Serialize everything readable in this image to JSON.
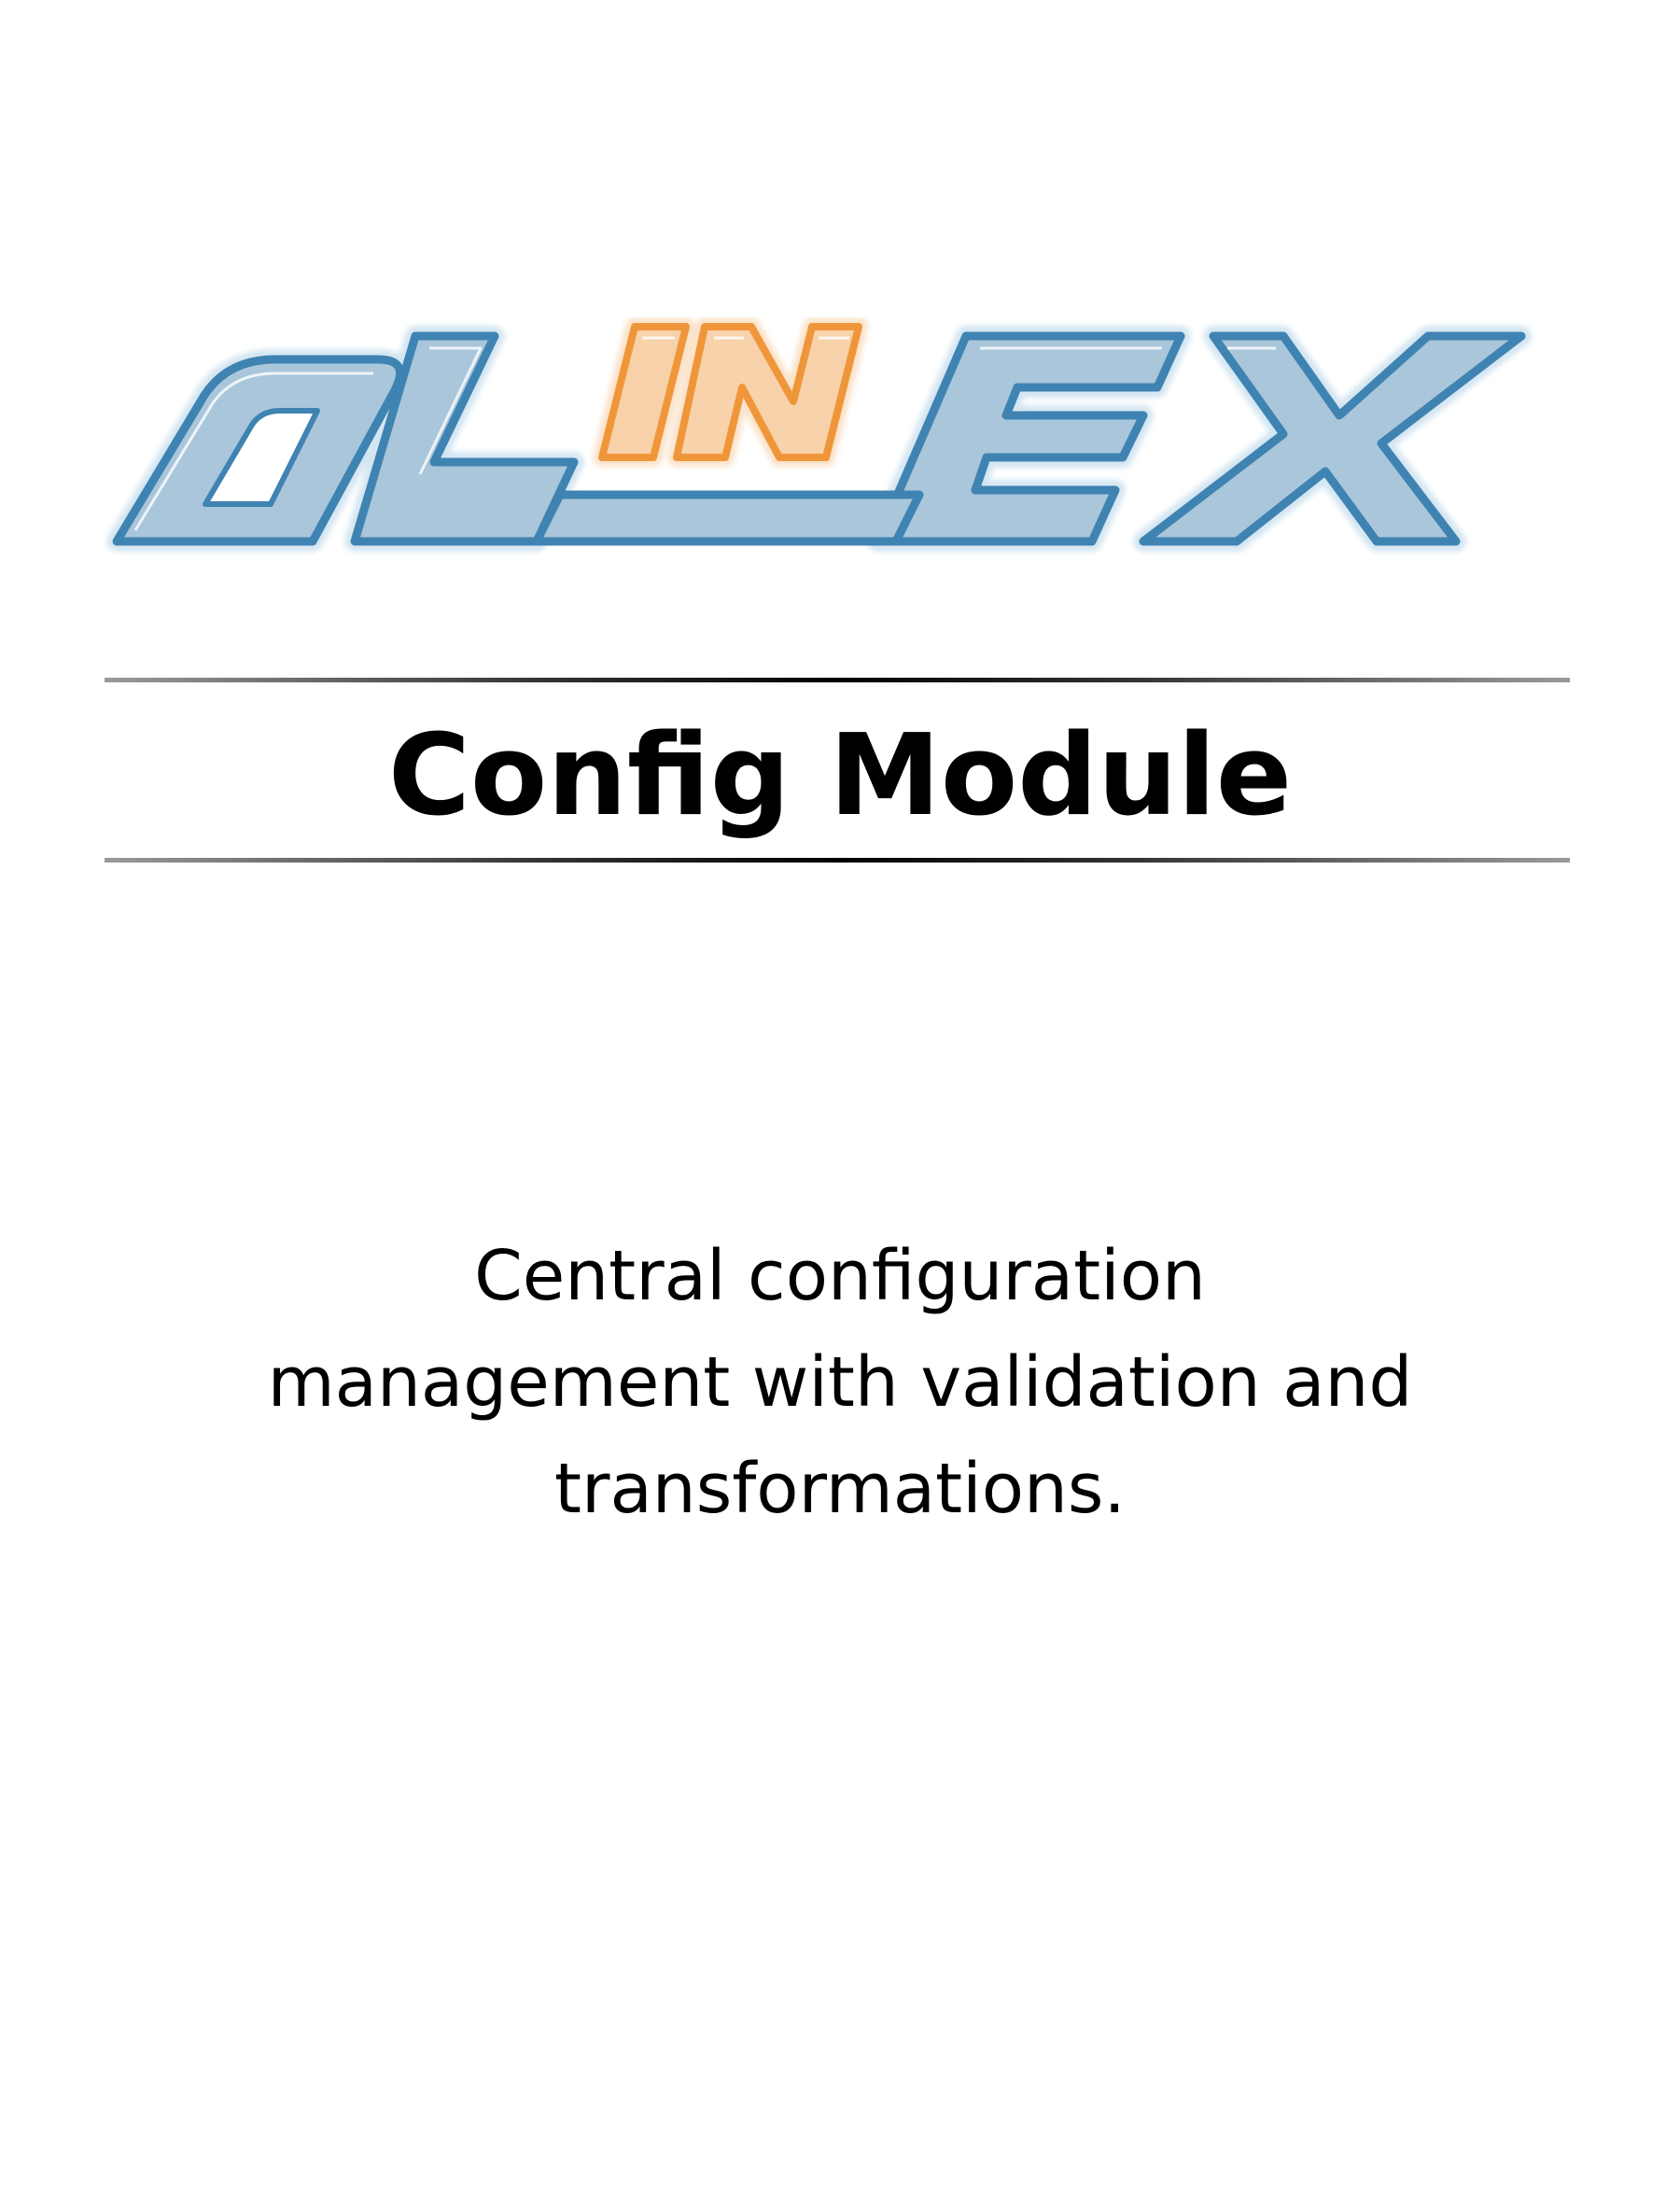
{
  "logo": {
    "name": "allinex-logo",
    "text": "ALLINEX",
    "colors": {
      "blue_fill": "#a9c6da",
      "blue_stroke": "#3f83b2",
      "blue_glow": "#d4e6f2",
      "orange_fill": "#f8d2ab",
      "orange_stroke": "#f0963a"
    }
  },
  "title": "Config Module",
  "description": "Central configuration management with validation and transformations."
}
